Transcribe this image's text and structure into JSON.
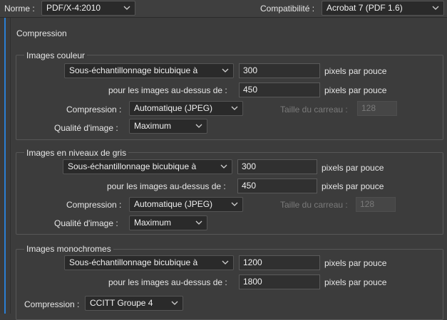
{
  "header": {
    "norme_label": "Norme :",
    "norme_value": "PDF/X-4:2010",
    "compat_label": "Compatibilité :",
    "compat_value": "Acrobat 7 (PDF 1.6)"
  },
  "section_title": "Compression",
  "color": {
    "title": "Images couleur",
    "resample_method": "Sous-échantillonnage bicubique à",
    "resolution": "300",
    "resolution_unit": "pixels par pouce",
    "above_label": "pour les images au-dessus de :",
    "above_value": "450",
    "above_unit": "pixels par pouce",
    "compression_label": "Compression :",
    "compression_value": "Automatique (JPEG)",
    "tile_label": "Taille du carreau :",
    "tile_value": "128",
    "quality_label": "Qualité d'image :",
    "quality_value": "Maximum"
  },
  "gray": {
    "title": "Images en niveaux de gris",
    "resample_method": "Sous-échantillonnage bicubique à",
    "resolution": "300",
    "resolution_unit": "pixels par pouce",
    "above_label": "pour les images au-dessus de :",
    "above_value": "450",
    "above_unit": "pixels par pouce",
    "compression_label": "Compression :",
    "compression_value": "Automatique (JPEG)",
    "tile_label": "Taille du carreau :",
    "tile_value": "128",
    "quality_label": "Qualité d'image :",
    "quality_value": "Maximum"
  },
  "mono": {
    "title": "Images monochromes",
    "resample_method": "Sous-échantillonnage bicubique à",
    "resolution": "1200",
    "resolution_unit": "pixels par pouce",
    "above_label": "pour les images au-dessus de :",
    "above_value": "1800",
    "above_unit": "pixels par pouce",
    "compression_label": "Compression :",
    "compression_value": "CCITT Groupe 4"
  },
  "icons": {
    "dropdown": "chevron-down-icon"
  },
  "colors": {
    "background": "#3c3c3c",
    "field": "#2a2a2a",
    "accent": "#2b7fd4"
  }
}
